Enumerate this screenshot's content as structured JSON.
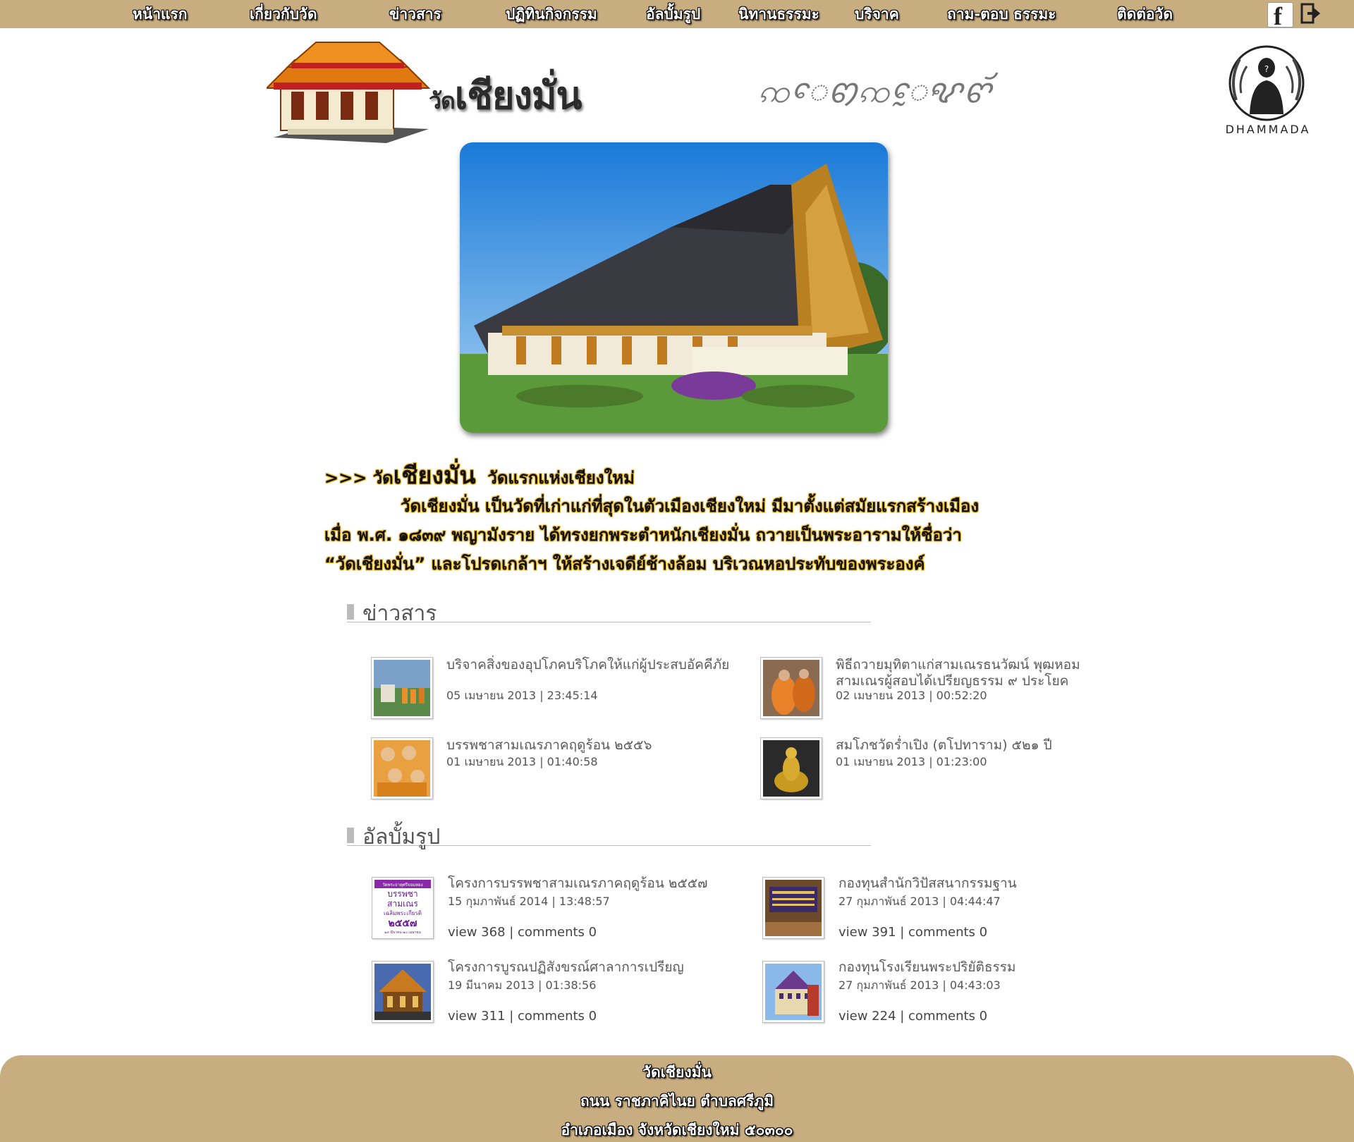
{
  "nav": {
    "items": [
      "หน้าแรก",
      "เกี่ยวกับวัด",
      "ข่าวสาร",
      "ปฏิทินกิจกรรม",
      "อัลบั้มรูป",
      "นิทานธรรมะ",
      "บริจาค",
      "ถาม-ตอบ ธรรมะ",
      "ติดต่อวัด"
    ]
  },
  "header": {
    "title_prefix": "วัด",
    "title_main": "เชียงมั่น",
    "lanna_text": "ꩡꨯꩅꩡꨰꨦꨓꨮ",
    "dhammada": "DHAMMADA"
  },
  "intro": {
    "arrows": ">>>",
    "name_prefix": "วัด",
    "name_main": "เชียงมั่น",
    "tagline": "วัดแรกแห่งเชียงใหม่",
    "line1": "วัดเชียงมั่น เป็นวัดที่เก่าแก่ที่สุดในตัวเมืองเชียงใหม่ มีมาตั้งแต่สมัยแรกสร้างเมือง",
    "line2": "เมื่อ พ.ศ. ๑๘๓๙ พญามังราย ได้ทรงยกพระตำหนักเชียงมั่น ถวายเป็นพระอารามให้ชื่อว่า",
    "line3": "“วัดเชียงมั่น” และโปรดเกล้าฯ ให้สร้างเจดีย์ช้างล้อม บริเวณหอประทับของพระองค์"
  },
  "news": {
    "heading": "ข่าวสาร",
    "items": [
      {
        "title": "บริจาคสิ่งของอุปโภคบริโภคให้แก่ผู้ประสบอัคคีภัย",
        "date": "05 เมษายน 2013 | 23:45:14"
      },
      {
        "title": "พิธีถวายมุทิตาแก่สามเณรธนวัฒน์ พุฒหอม สามเณรผู้สอบได้เปรียญธรรม ๙ ประโยค",
        "date": "02 เมษายน 2013 | 00:52:20"
      },
      {
        "title": "บรรพชาสามเณรภาคฤดูร้อน ๒๕๕๖",
        "date": "01 เมษายน 2013 | 01:40:58"
      },
      {
        "title": "สมโภชวัดร่ำเปิง (ตโปทาราม) ๕๒๑ ปี",
        "date": "01 เมษายน 2013 | 01:23:00"
      }
    ]
  },
  "album": {
    "heading": "อัลบั้มรูป",
    "poster_lines": [
      "วัดพระธาตุศรีจอมทอง",
      "บรรพชา",
      "สามเณร",
      "เฉลิมพระเกียรติ",
      "๒๕๕๗",
      "๑๙ มีนาคม-๑๐ เมษายน"
    ],
    "items": [
      {
        "title": "โครงการบรรพชาสามเณรภาคฤดูร้อน ๒๕๕๗",
        "date": "15 กุมภาพันธ์ 2014 | 13:48:57",
        "stats": "view 368 | comments 0"
      },
      {
        "title": "กองทุนสำนักวิปัสสนากรรมฐาน",
        "date": "27 กุมภาพันธ์ 2013 | 04:44:47",
        "stats": "view 391 | comments 0"
      },
      {
        "title": "โครงการบูรณปฏิสังขรณ์ศาลาการเปรียญ",
        "date": "19 มีนาคม 2013 | 01:38:56",
        "stats": "view 311 | comments 0"
      },
      {
        "title": "กองทุนโรงเรียนพระปริยัติธรรม",
        "date": "27 กุมภาพันธ์ 2013 | 04:43:03",
        "stats": "view 224 | comments 0"
      }
    ]
  },
  "footer": {
    "line1": "วัดเชียงมั่น",
    "line2": "ถนน ราชภาคิไนย ตำบลศรีภูมิ",
    "line3": "อำเภอเมือง จังหวัดเชียงใหม่ ๕๐๓๐๐"
  },
  "colors": {
    "nav_bg": "#c8ad80",
    "intro_glow": "#e8b830"
  }
}
